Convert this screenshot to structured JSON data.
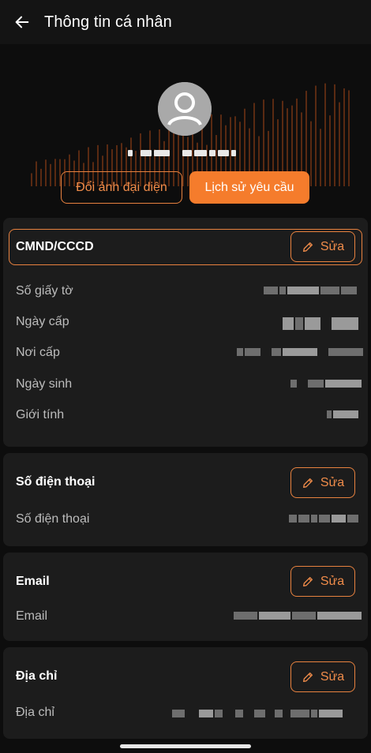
{
  "appbar": {
    "title": "Thông tin cá nhân",
    "back_icon": "arrow-left-icon"
  },
  "profile": {
    "avatar_icon": "user-avatar-icon",
    "change_avatar_label": "Đổi ảnh đại diện",
    "request_history_label": "Lịch sử yêu cầu"
  },
  "colors": {
    "accent": "#f57c2c",
    "accent_text": "#f08c4a",
    "card_bg": "#1c1c1c",
    "page_bg": "#0d0d0d"
  },
  "id_card": {
    "title": "CMND/CCCD",
    "edit_label": "Sửa",
    "fields": [
      {
        "label": "Số giấy tờ"
      },
      {
        "label": "Ngày cấp"
      },
      {
        "label": "Nơi cấp"
      },
      {
        "label": "Ngày sinh"
      },
      {
        "label": "Giới tính"
      }
    ]
  },
  "phone": {
    "title": "Số điện thoại",
    "edit_label": "Sửa",
    "field_label": "Số điện thoại"
  },
  "email": {
    "title": "Email",
    "edit_label": "Sửa",
    "field_label": "Email"
  },
  "address": {
    "title": "Địa chỉ",
    "edit_label": "Sửa",
    "field_label": "Địa chỉ"
  }
}
